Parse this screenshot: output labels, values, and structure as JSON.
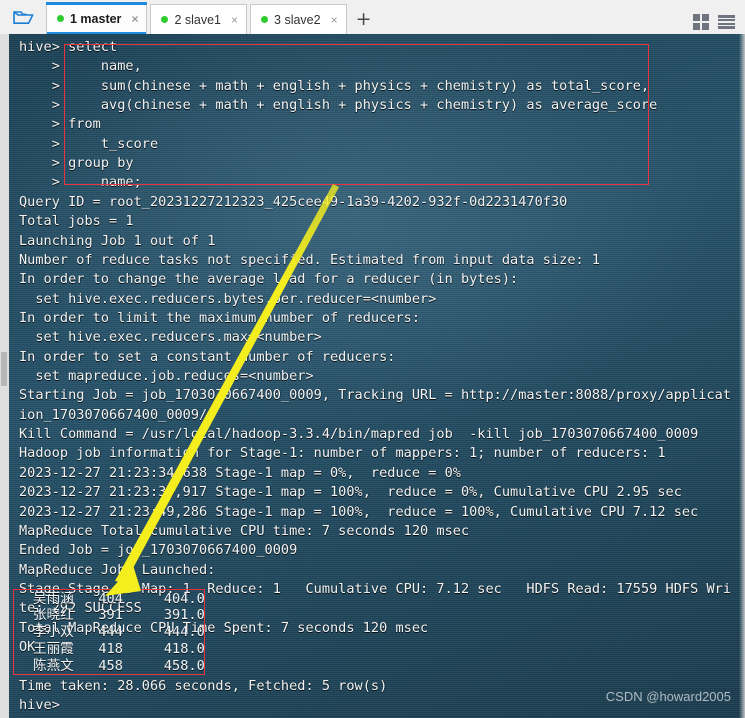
{
  "window": {
    "folder_icon": "open-folder-icon",
    "grid_icon": "grid-view-icon",
    "menu_icon": "hamburger-menu-icon",
    "new_tab_label": "+"
  },
  "tabs": [
    {
      "label": "1 master",
      "active": true,
      "status_color": "#2ecb2e",
      "close": "×"
    },
    {
      "label": "2 slave1",
      "active": false,
      "status_color": "#2ecb2e",
      "close": "×"
    },
    {
      "label": "3 slave2",
      "active": false,
      "status_color": "#2ecb2e",
      "close": "×"
    }
  ],
  "terminal": {
    "bg_color": "#1d4357",
    "fg_color": "#f2f4f5",
    "prompt": "hive>",
    "sql_block": "hive> select\n    >     name,\n    >     sum(chinese + math + english + physics + chemistry) as total_score,\n    >     avg(chinese + math + english + physics + chemistry) as average_score\n    > from\n    >     t_score\n    > group by\n    >     name;",
    "output": "Query ID = root_20231227212323_425cee49-1a39-4202-932f-0d2231470f30\nTotal jobs = 1\nLaunching Job 1 out of 1\nNumber of reduce tasks not specified. Estimated from input data size: 1\nIn order to change the average load for a reducer (in bytes):\n  set hive.exec.reducers.bytes.per.reducer=<number>\nIn order to limit the maximum number of reducers:\n  set hive.exec.reducers.max=<number>\nIn order to set a constant number of reducers:\n  set mapreduce.job.reduces=<number>\nStarting Job = job_1703070667400_0009, Tracking URL = http://master:8088/proxy/applicat\nion_1703070667400_0009/\nKill Command = /usr/local/hadoop-3.3.4/bin/mapred job  -kill job_1703070667400_0009\nHadoop job information for Stage-1: number of mappers: 1; number of reducers: 1\n2023-12-27 21:23:34,638 Stage-1 map = 0%,  reduce = 0%\n2023-12-27 21:23:39,917 Stage-1 map = 100%,  reduce = 0%, Cumulative CPU 2.95 sec\n2023-12-27 21:23:49,286 Stage-1 map = 100%,  reduce = 100%, Cumulative CPU 7.12 sec\nMapReduce Total cumulative CPU time: 7 seconds 120 msec\nEnded Job = job_1703070667400_0009\nMapReduce Jobs Launched:\nStage-Stage-1: Map: 1  Reduce: 1   Cumulative CPU: 7.12 sec   HDFS Read: 17559 HDFS Wri\nte: 292 SUCCESS\nTotal MapReduce CPU Time Spent: 7 seconds 120 msec\nOK",
    "result_rows": [
      {
        "name": "吴雨涵",
        "total_score": "404",
        "average_score": "404.0"
      },
      {
        "name": "张晓红",
        "total_score": "391",
        "average_score": "391.0"
      },
      {
        "name": "李小双",
        "total_score": "444",
        "average_score": "444.0"
      },
      {
        "name": "王丽霞",
        "total_score": "418",
        "average_score": "418.0"
      },
      {
        "name": "陈燕文",
        "total_score": "458",
        "average_score": "458.0"
      }
    ],
    "footer": "Time taken: 28.066 seconds, Fetched: 5 row(s)\nhive>"
  },
  "annotations": {
    "box_color": "#e8323c",
    "arrow_color": "#f5ee1e",
    "sql_box_label": "highlight-sql-query",
    "result_box_label": "highlight-result-rows",
    "arrow_label": "arrow-pointing-to-results"
  },
  "watermark": "CSDN @howard2005"
}
